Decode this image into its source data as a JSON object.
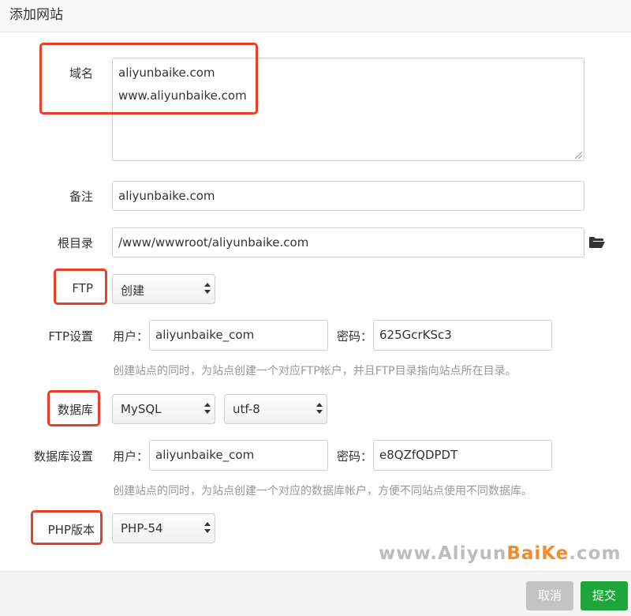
{
  "dialog": {
    "title": "添加网站"
  },
  "form": {
    "domain": {
      "label": "域名",
      "lines": [
        "aliyunbaike.com",
        "www.aliyunbaike.com"
      ]
    },
    "remark": {
      "label": "备注",
      "value": "aliyunbaike.com"
    },
    "root": {
      "label": "根目录",
      "value": "/www/wwwroot/aliyunbaike.com",
      "icon": "folder-open-icon"
    },
    "ftp": {
      "label": "FTP",
      "selected": "创建"
    },
    "ftp_settings": {
      "label": "FTP设置",
      "user_label": "用户：",
      "user_value": "aliyunbaike_com",
      "pass_label": "密码：",
      "pass_value": "625GcrKSc3",
      "help": "创建站点的同时，为站点创建一个对应FTP帐户，并且FTP目录指向站点所在目录。"
    },
    "database": {
      "label": "数据库",
      "type_selected": "MySQL",
      "charset_selected": "utf-8"
    },
    "db_settings": {
      "label": "数据库设置",
      "user_label": "用户：",
      "user_value": "aliyunbaike_com",
      "pass_label": "密码：",
      "pass_value": "e8QZfQDPDT",
      "help": "创建站点的同时，为站点创建一个对应的数据库帐户，方便不同站点使用不同数据库。"
    },
    "php": {
      "label": "PHP版本",
      "selected": "PHP-54"
    }
  },
  "watermark": {
    "prefix": "www.Aliyun",
    "accent": "BaiKe",
    "suffix": ".com"
  },
  "footer": {
    "cancel_label": "取消",
    "submit_label": "提交"
  },
  "colors": {
    "highlight": "#ea3f2a",
    "submit": "#20a53a",
    "cancel": "#c4c4c4",
    "watermark_accent": "#f08c2c"
  }
}
